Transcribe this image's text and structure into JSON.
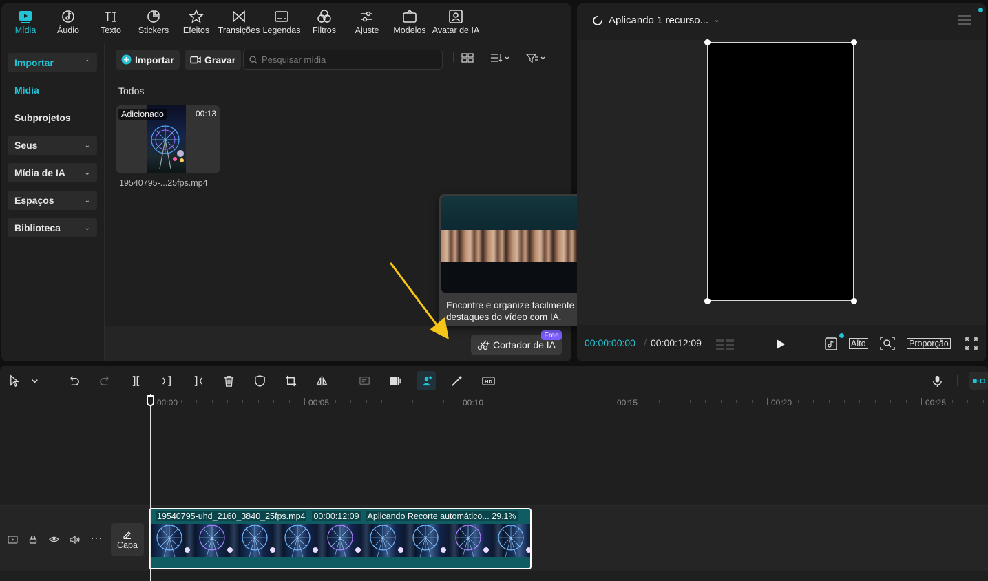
{
  "toolbar": {
    "tabs": [
      {
        "label": "Mídia",
        "icon": "media-icon",
        "active": true
      },
      {
        "label": "Áudio",
        "icon": "audio-icon"
      },
      {
        "label": "Texto",
        "icon": "text-icon"
      },
      {
        "label": "Stickers",
        "icon": "sticker-icon"
      },
      {
        "label": "Efeitos",
        "icon": "effects-icon"
      },
      {
        "label": "Transições",
        "icon": "transitions-icon"
      },
      {
        "label": "Legendas",
        "icon": "captions-icon"
      },
      {
        "label": "Filtros",
        "icon": "filters-icon"
      },
      {
        "label": "Ajuste",
        "icon": "adjust-icon"
      },
      {
        "label": "Modelos",
        "icon": "templates-icon"
      },
      {
        "label": "Avatar de IA",
        "icon": "ai-avatar-icon"
      }
    ]
  },
  "sidebar": {
    "items": [
      {
        "label": "Importar",
        "expanded": true
      },
      {
        "label": "Mídia"
      },
      {
        "label": "Subprojetos"
      },
      {
        "label": "Seus"
      },
      {
        "label": "Mídia de IA"
      },
      {
        "label": "Espaços"
      },
      {
        "label": "Biblioteca"
      }
    ]
  },
  "media": {
    "import_label": "Importar",
    "record_label": "Gravar",
    "search_placeholder": "Pesquisar mídia",
    "section_label": "Todos",
    "file": {
      "badge": "Adicionado",
      "duration": "00:13",
      "name": "19540795-...25fps.mp4"
    },
    "ai_cutter_label": "Cortador de IA",
    "free_badge": "Free"
  },
  "popover": {
    "description": "Encontre e organize facilmente os destaques do vídeo com IA."
  },
  "preview": {
    "title": "Aplicando 1 recurso...",
    "current_time": "00:00:00:00",
    "total_time": "00:00:12:09",
    "quality_label": "Alto",
    "ratio_label": "Proporção"
  },
  "timeline": {
    "ruler_labels": [
      "00:00",
      "00:05",
      "00:10",
      "00:15",
      "00:20",
      "00:25"
    ],
    "cover_label": "Capa",
    "clip": {
      "name": "19540795-uhd_2160_3840_25fps.mp4",
      "duration": "00:00:12:09",
      "status": "Aplicando Recorte automático... 29.1%"
    }
  },
  "colors": {
    "accent": "#21c4d6",
    "clip": "#0f5c63",
    "free_badge": "#7b5cff",
    "arrow": "#f5c518"
  }
}
